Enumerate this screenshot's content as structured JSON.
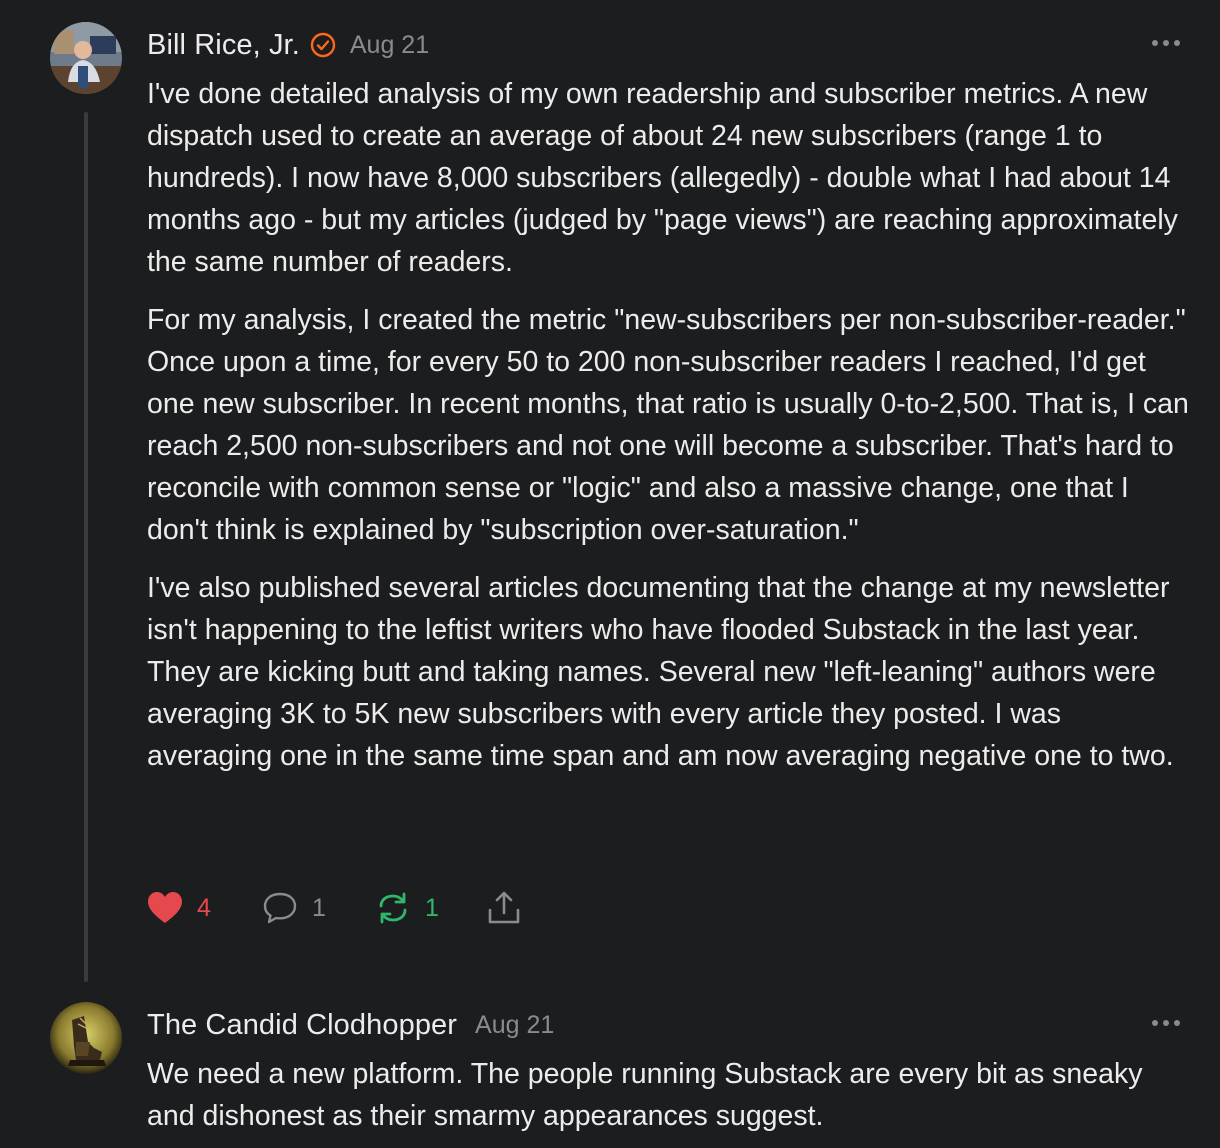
{
  "comments": [
    {
      "author": "Bill Rice, Jr.",
      "date": "Aug 21",
      "verified": true,
      "paragraphs": [
        "I've done detailed analysis of my own readership and subscriber metrics. A new dispatch used to create an average of about 24 new subscribers (range 1 to hundreds). I now have 8,000 subscribers (allegedly) - double what I had about 14 months ago - but my articles (judged by \"page views\") are reaching approximately the same number of readers.",
        "For my analysis, I created the metric \"new-subscribers per non-subscriber-reader.\" Once upon a time, for every 50 to 200 non-subscriber readers I reached, I'd get one new subscriber. In recent months, that ratio is usually 0-to-2,500. That is, I can reach 2,500 non-subscribers and not one will become a subscriber. That's hard to reconcile with common sense or \"logic\" and also a massive change, one that I don't think is explained by \"subscription over-saturation.\"",
        "I've also published several articles documenting that the change at my newsletter isn't happening to the leftist writers who have flooded Substack in the last year. They are kicking butt and taking names. Several new \"left-leaning\" authors were averaging 3K to 5K new subscribers with every article they posted. I was averaging one in the same time span and am now averaging negative one to two."
      ],
      "likes": "4",
      "replies": "1",
      "restacks": "1"
    },
    {
      "author": "The Candid Clodhopper",
      "date": "Aug 21",
      "paragraphs": [
        "We need a new platform. The people running Substack are every bit as sneaky and dishonest as their smarmy appearances suggest."
      ]
    }
  ],
  "icons": {
    "like": "heart-icon",
    "reply": "speech-bubble-icon",
    "restack": "restack-arrows-icon",
    "share": "share-icon",
    "more": "more-dots-icon",
    "verified": "verified-check-icon"
  },
  "colors": {
    "background": "#1c1d1f",
    "like": "#e5484d",
    "restack": "#2fb86b",
    "verified": "#ff6719",
    "muted": "#8a8b8e"
  }
}
